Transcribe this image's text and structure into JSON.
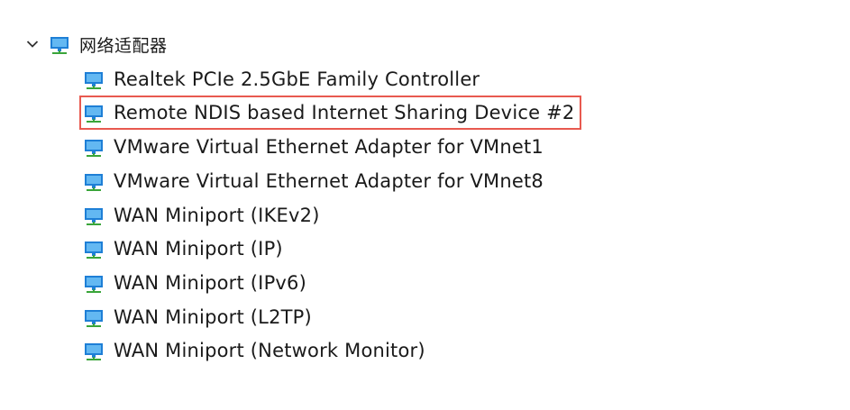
{
  "tree": {
    "category": {
      "label": "网络适配器",
      "expanded": true,
      "icon": "network-adapter-icon"
    },
    "devices": [
      {
        "label": "Realtek PCIe 2.5GbE Family Controller",
        "selected": false
      },
      {
        "label": "Remote NDIS based Internet Sharing Device #2",
        "selected": true
      },
      {
        "label": "VMware Virtual Ethernet Adapter for VMnet1",
        "selected": false
      },
      {
        "label": "VMware Virtual Ethernet Adapter for VMnet8",
        "selected": false
      },
      {
        "label": "WAN Miniport (IKEv2)",
        "selected": false
      },
      {
        "label": "WAN Miniport (IP)",
        "selected": false
      },
      {
        "label": "WAN Miniport (IPv6)",
        "selected": false
      },
      {
        "label": "WAN Miniport (L2TP)",
        "selected": false
      },
      {
        "label": "WAN Miniport (Network Monitor)",
        "selected": false
      }
    ]
  },
  "colors": {
    "highlight_border": "#e8594f",
    "icon_monitor": "#1e7fd6",
    "icon_screen": "#63b8f2",
    "icon_cable": "#3aa53a"
  }
}
